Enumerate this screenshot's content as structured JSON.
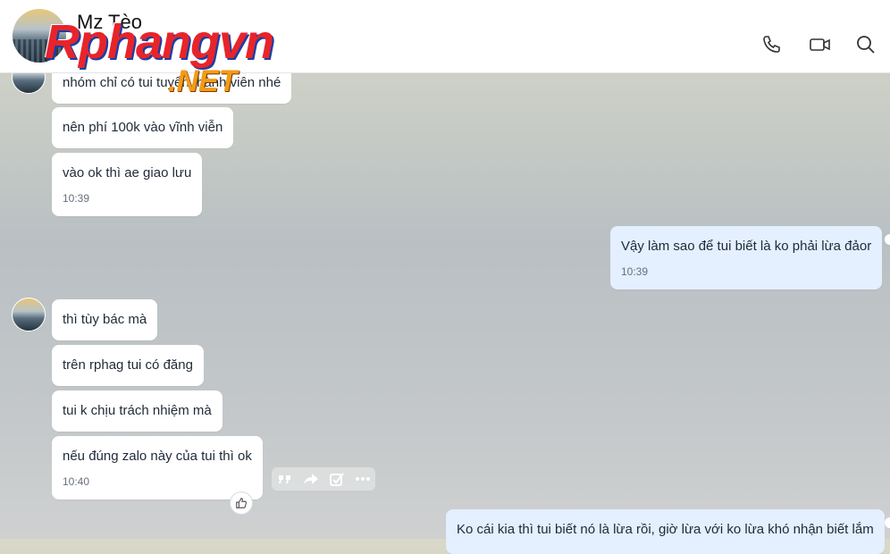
{
  "header": {
    "contact_name": "Mz Tèo",
    "watermark_main": "Rphangvn",
    "watermark_sub": ".NET",
    "icons": [
      "phone-icon",
      "video-call-icon",
      "search-icon"
    ]
  },
  "messages": [
    {
      "side": "in",
      "text": "nhóm chỉ có tui tuyển thành viên nhé"
    },
    {
      "side": "in",
      "text": "nên phí 100k vào vĩnh viễn"
    },
    {
      "side": "in",
      "text": "vào ok thì ae giao lưu",
      "time": "10:39"
    },
    {
      "side": "out",
      "text": "Vậy làm sao để tui biết là ko phải lừa đảor",
      "time": "10:39"
    },
    {
      "side": "in",
      "text": "thì tùy bác mà"
    },
    {
      "side": "in",
      "text": "trên rphag tui có đăng"
    },
    {
      "side": "in",
      "text": "tui k chịu trách nhiệm mà"
    },
    {
      "side": "in",
      "text": "nếu đúng zalo này của tui thì ok",
      "time": "10:40"
    },
    {
      "side": "out",
      "text": "Ko cái kia thì tui biết nó là lừa rồi, giờ lừa với ko lừa khó nhận biết lắm"
    }
  ],
  "message_actions": [
    "quote-icon",
    "forward-icon",
    "task-icon",
    "more-icon"
  ],
  "reaction_icon": "thumbs-up-icon",
  "colors": {
    "incoming_bubble": "#ffffff",
    "outgoing_bubble": "#e4efff",
    "watermark_red": "#e8242b",
    "watermark_orange": "#f39b16"
  }
}
